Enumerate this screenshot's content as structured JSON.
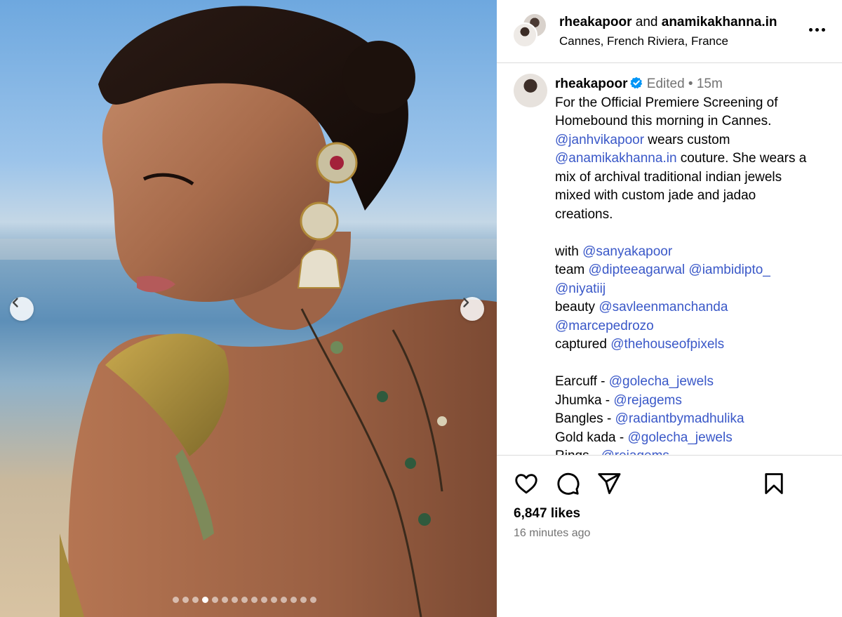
{
  "photo": {
    "description_icon": "photo-carousel",
    "dot_count": 15,
    "active_dot": 3
  },
  "header": {
    "user1": "rheakapoor",
    "joiner": "and",
    "user2": "anamikakhanna.in",
    "location": "Cannes, French Riviera, France"
  },
  "caption": {
    "username": "rheakapoor",
    "edited": "Edited",
    "separator": "•",
    "time": "15m",
    "lines": [
      [
        {
          "t": "For the Official Premiere Screening of"
        }
      ],
      [
        {
          "t": "Homebound this morning in Cannes."
        }
      ],
      [
        {
          "t": "@janhvikapoor",
          "m": true
        },
        {
          "t": " wears custom"
        }
      ],
      [
        {
          "t": "@anamikakhanna.in",
          "m": true
        },
        {
          "t": " couture. She wears a"
        }
      ],
      [
        {
          "t": "mix of archival traditional indian jewels"
        }
      ],
      [
        {
          "t": "mixed with custom jade and jadao"
        }
      ],
      [
        {
          "t": "creations."
        }
      ],
      [],
      [
        {
          "t": "with "
        },
        {
          "t": "@sanyakapoor",
          "m": true
        }
      ],
      [
        {
          "t": "team "
        },
        {
          "t": "@dipteeagarwal",
          "m": true
        },
        {
          "t": " "
        },
        {
          "t": "@iambidipto_",
          "m": true
        }
      ],
      [
        {
          "t": "@niyatiij",
          "m": true
        }
      ],
      [
        {
          "t": "beauty "
        },
        {
          "t": "@savleenmanchanda",
          "m": true
        }
      ],
      [
        {
          "t": "@marcepedrozo",
          "m": true
        }
      ],
      [
        {
          "t": "captured "
        },
        {
          "t": "@thehouseofpixels",
          "m": true
        }
      ],
      [],
      [
        {
          "t": "Earcuff - "
        },
        {
          "t": "@golecha_jewels",
          "m": true
        }
      ],
      [
        {
          "t": "Jhumka - "
        },
        {
          "t": "@rejagems",
          "m": true
        }
      ],
      [
        {
          "t": "Bangles - "
        },
        {
          "t": "@radiantbymadhulika",
          "m": true
        }
      ],
      [
        {
          "t": "Gold kada - "
        },
        {
          "t": "@golecha_jewels",
          "m": true
        }
      ],
      [
        {
          "t": "Rings - "
        },
        {
          "t": "@rejagems",
          "m": true
        }
      ]
    ]
  },
  "footer": {
    "likes": "6,847 likes",
    "time_ago": "16 minutes ago"
  },
  "colors": {
    "mention": "#3a58c8",
    "meta": "#737373",
    "verified": "#0095f6",
    "divider": "#dbdbdb"
  }
}
